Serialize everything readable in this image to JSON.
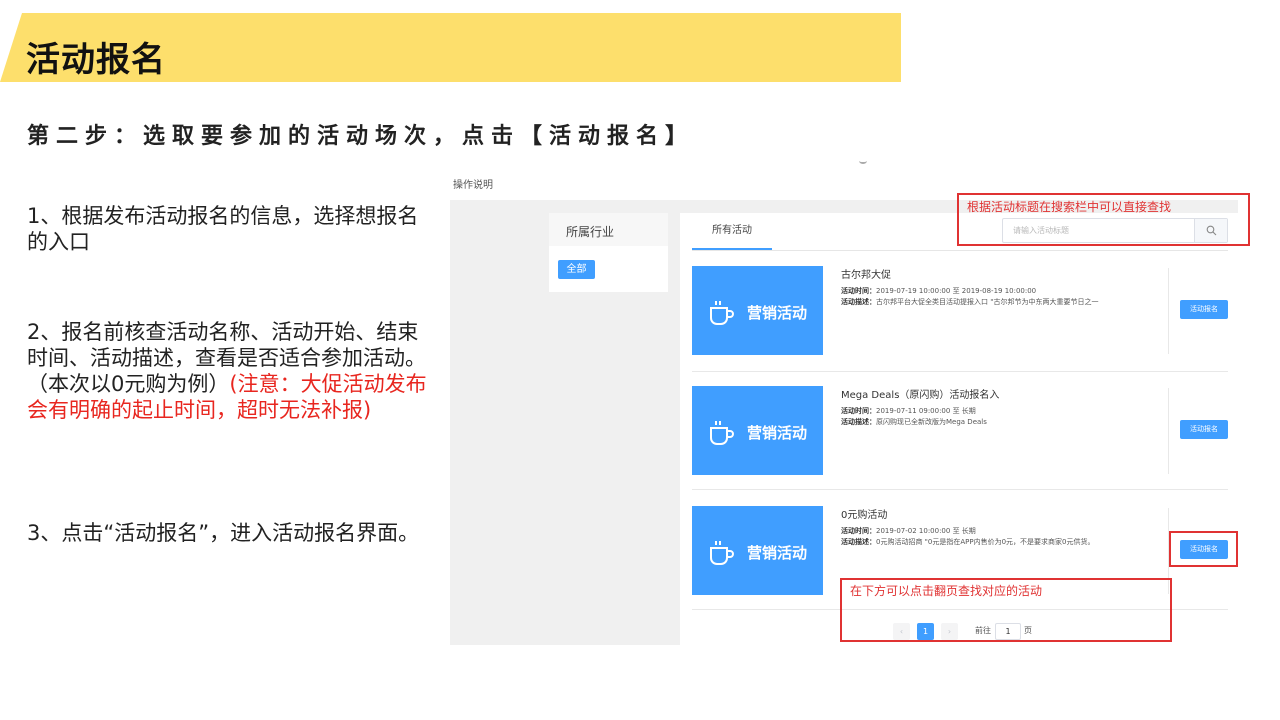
{
  "slide": {
    "title": "活动报名",
    "subtitle": "第二步：选取要参加的活动场次，点击【活动报名】",
    "steps": [
      {
        "text": "1、根据发布活动报名的信息，选择想报名的入口",
        "warning": ""
      },
      {
        "text": "2、报名前核查活动名称、活动开始、结束时间、活动描述，查看是否适合参加活动。（本次以0元购为例）",
        "warning": "(注意：大促活动发布会有明确的起止时间，超时无法补报)"
      },
      {
        "text": "3、点击“活动报名”，进入活动报名界面。",
        "warning": ""
      }
    ],
    "colors": {
      "title_band": "#fddf6c",
      "accent": "#409eff",
      "annotation": "#e03232"
    }
  },
  "screenshot": {
    "op_label": "操作说明",
    "sidebar": {
      "header": "所属行业",
      "chip": "全部"
    },
    "tab": "所有活动",
    "search": {
      "placeholder": "请输入活动标题",
      "value": "",
      "icon": "search-icon"
    },
    "activities": [
      {
        "banner": "营销活动",
        "title": "古尔邦大促",
        "time_label": "活动时间：",
        "time": "2019-07-19 10:00:00 至 2019-08-19 10:00:00",
        "desc_label": "活动描述：",
        "desc": "古尔邦平台大促全类目活动提报入口 \"古尔邦节为中东两大重要节日之一",
        "button": "活动报名"
      },
      {
        "banner": "营销活动",
        "title": "Mega Deals（原闪购）活动报名入",
        "time_label": "活动时间：",
        "time": "2019-07-11 09:00:00 至 长期",
        "desc_label": "活动描述：",
        "desc": "原闪购现已全新改版为Mega Deals",
        "button": "活动报名"
      },
      {
        "banner": "营销活动",
        "title": "0元购活动",
        "time_label": "活动时间：",
        "time": "2019-07-02 10:00:00 至 长期",
        "desc_label": "活动描述：",
        "desc": "0元购活动招商 \"0元是指在APP内售价为0元，不是要求商家0元供货。",
        "button": "活动报名"
      }
    ],
    "pagination": {
      "prev": "‹",
      "current": "1",
      "next": "›",
      "goto_label": "前往",
      "goto_value": "1",
      "page_suffix": "页"
    },
    "annotations": {
      "search_note": "根据活动标题在搜索栏中可以直接查找",
      "pager_note": "在下方可以点击翻页查找对应的活动"
    }
  }
}
